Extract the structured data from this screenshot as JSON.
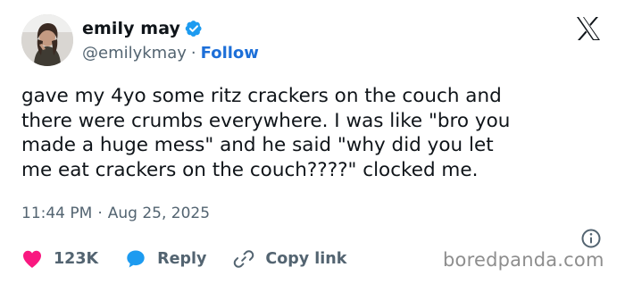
{
  "author": {
    "display_name": "emily may",
    "handle": "@emilykmay",
    "separator": "·",
    "follow_label": "Follow"
  },
  "tweet": {
    "text": "gave my 4yo some ritz crackers on the couch and\nthere were crumbs everywhere. I was like \"bro you\nmade a huge mess\" and he said \"why did you let\nme eat crackers on the couch????\" clocked me.",
    "time": "11:44 PM",
    "separator": "·",
    "date": "Aug 25, 2025"
  },
  "actions": {
    "likes": "123K",
    "reply_label": "Reply",
    "copy_link_label": "Copy link"
  },
  "watermark": "boredpanda.com",
  "icons": {
    "avatar": "profile-photo",
    "verified": "verified-badge-icon",
    "brand": "x-logo-icon",
    "info": "info-icon",
    "like": "heart-icon",
    "reply": "speech-bubble-icon",
    "copy_link": "link-icon"
  },
  "colors": {
    "verified": "#1d9bf0",
    "follow": "#1d6fd8",
    "heart": "#f91880",
    "reply_bubble": "#1d9bf0",
    "muted_text": "#536471",
    "watermark": "#8e8e8e"
  }
}
